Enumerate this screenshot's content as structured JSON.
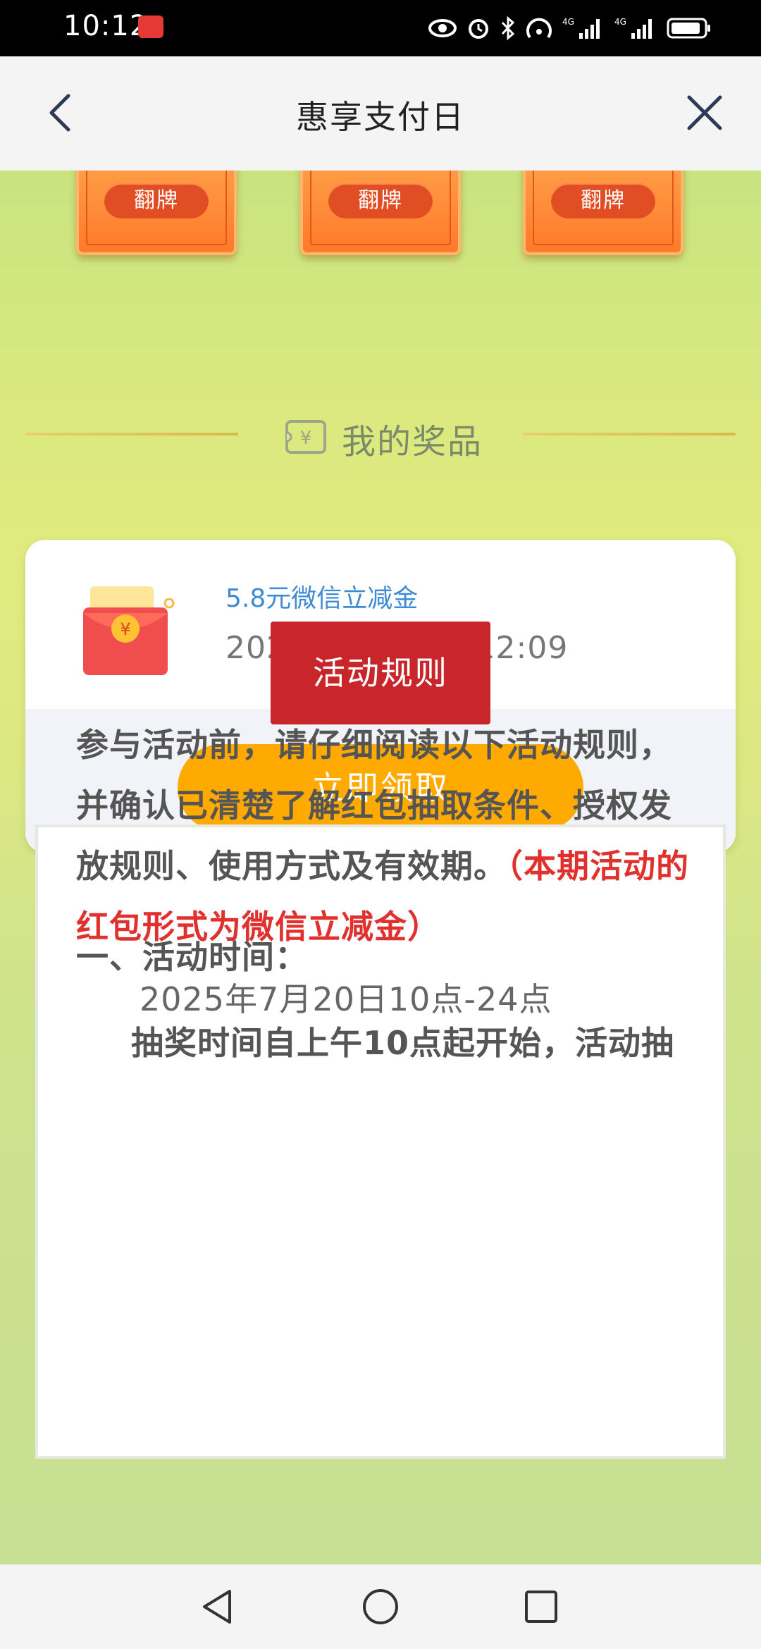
{
  "status_bar": {
    "time": "10:12",
    "icons": [
      "eye-icon",
      "alarm-icon",
      "bluetooth-icon",
      "hotspot-icon",
      "signal-4g-icon",
      "signal-4g-icon",
      "battery-icon"
    ]
  },
  "header": {
    "title": "惠享支付日"
  },
  "flip_cards": [
    {
      "label": "翻牌"
    },
    {
      "label": "翻牌"
    },
    {
      "label": "翻牌"
    }
  ],
  "prizes": {
    "heading": "我的奖品",
    "item": {
      "name": "5.8元微信立减金",
      "time": "2025-07-20 10:12:09",
      "button": "立即领取"
    }
  },
  "rules": {
    "tab": "活动规则",
    "intro": "参与活动前，请仔细阅读以下活动规则，并确认已清楚了解红包抽取条件、授权发放规则、使用方式及有效期。",
    "intro_red": "（本期活动的红包形式为微信立减金）",
    "section1_title": "一、活动时间：",
    "section1_date": "2025年7月20日10点-24点",
    "section1_note": "抽奖时间自上午10点起开始，活动抽"
  },
  "colors": {
    "accent_orange": "#ffaa00",
    "rules_red": "#c8262b",
    "link_blue": "#3e8bd4"
  }
}
